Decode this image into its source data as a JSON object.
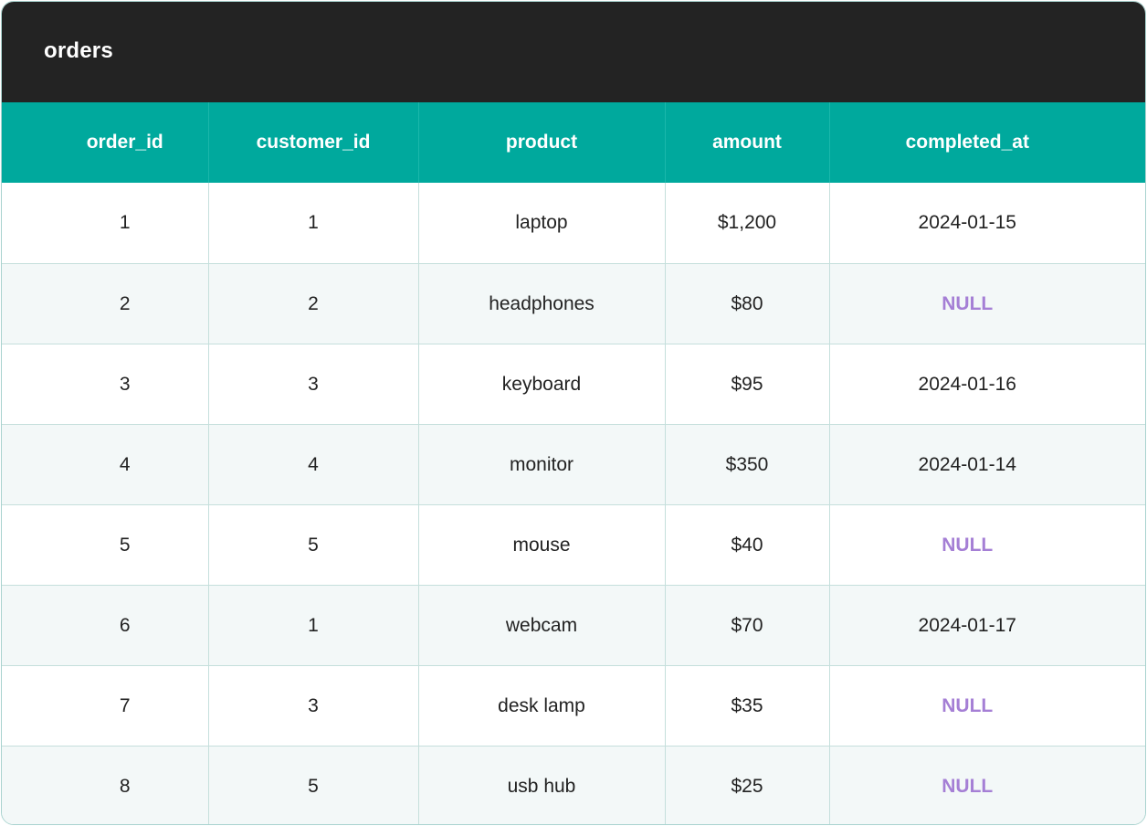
{
  "table": {
    "title": "orders",
    "columns": [
      "order_id",
      "customer_id",
      "product",
      "amount",
      "completed_at"
    ],
    "rows": [
      [
        "1",
        "1",
        "laptop",
        "$1,200",
        "2024-01-15"
      ],
      [
        "2",
        "2",
        "headphones",
        "$80",
        "NULL"
      ],
      [
        "3",
        "3",
        "keyboard",
        "$95",
        "2024-01-16"
      ],
      [
        "4",
        "4",
        "monitor",
        "$350",
        "2024-01-14"
      ],
      [
        "5",
        "5",
        "mouse",
        "$40",
        "NULL"
      ],
      [
        "6",
        "1",
        "webcam",
        "$70",
        "2024-01-17"
      ],
      [
        "7",
        "3",
        "desk lamp",
        "$35",
        "NULL"
      ],
      [
        "8",
        "5",
        "usb hub",
        "$25",
        "NULL"
      ]
    ]
  },
  "colors": {
    "title_bar": "#232323",
    "header": "#00a99d",
    "null_text": "#a57fd5",
    "row_alt": "#f3f8f8"
  }
}
